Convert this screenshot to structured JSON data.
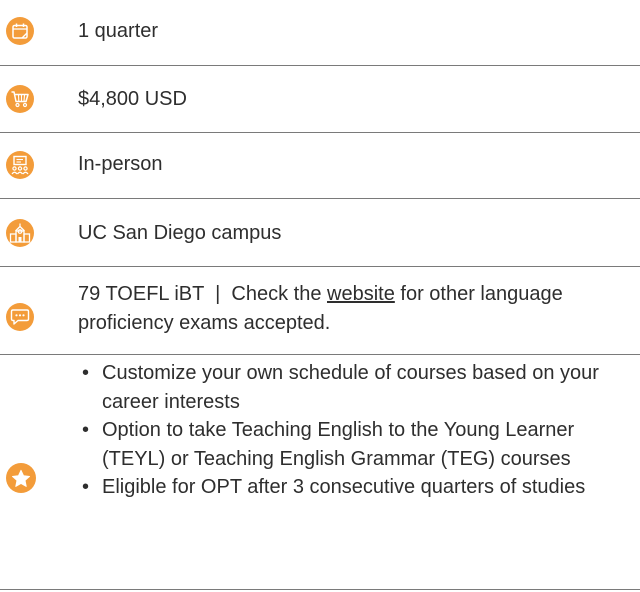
{
  "colors": {
    "accent": "#f39c3a",
    "divider": "#7a7a7a",
    "text": "#2e2e2e"
  },
  "rows": [
    {
      "icon": "calendar-icon",
      "text": "1 quarter"
    },
    {
      "icon": "shopping-cart-icon",
      "text": "$4,800 USD"
    },
    {
      "icon": "classroom-icon",
      "text": "In-person"
    },
    {
      "icon": "campus-building-icon",
      "text": "UC San Diego campus"
    }
  ],
  "requirements": {
    "icon": "chat-bubble-icon",
    "before": "79 TOEFL iBT  |  Check the ",
    "link": "website",
    "after": " for other language proficiency exams accepted."
  },
  "highlights": {
    "icon": "star-icon",
    "bullet": "•",
    "items": [
      "Customize your own schedule of courses based on your career interests",
      "Option to take Teaching English to the Young Learner (TEYL) or Teaching English Grammar (TEG) courses",
      "Eligible for OPT after 3 consecutive quarters of studies"
    ]
  }
}
